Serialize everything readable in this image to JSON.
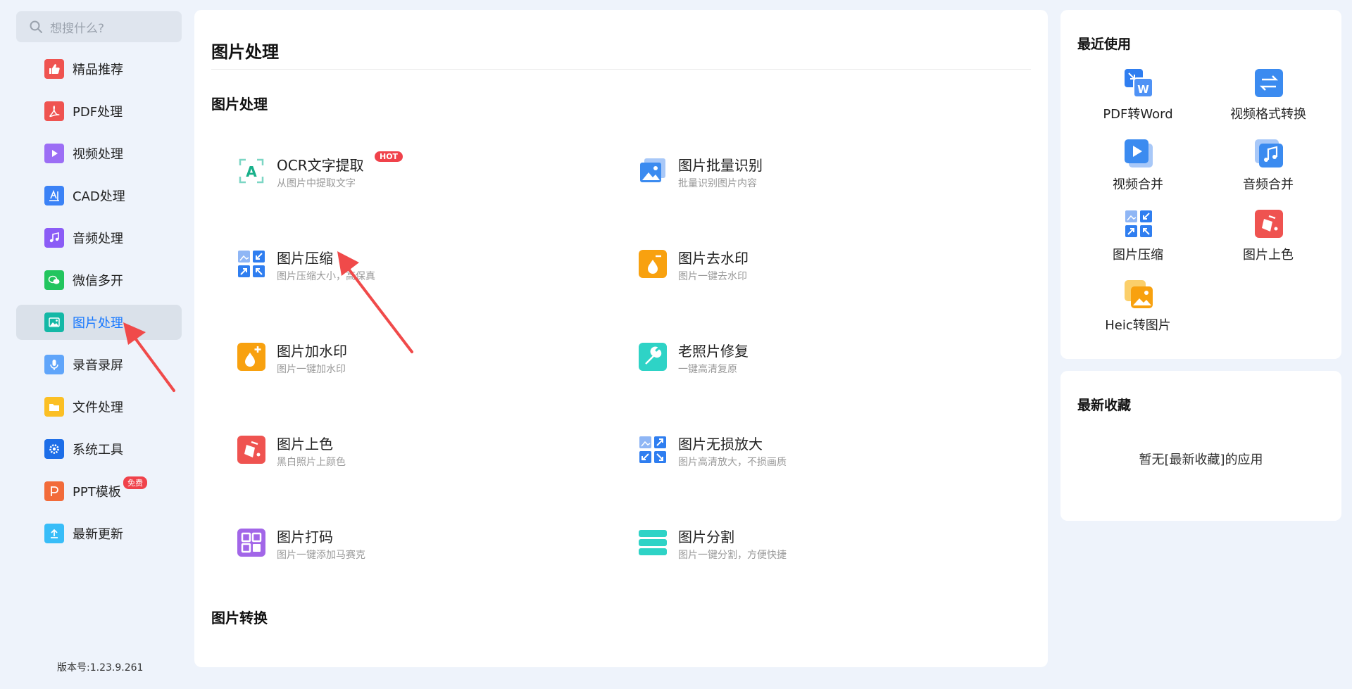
{
  "search": {
    "placeholder": "想搜什么?"
  },
  "sidebar": {
    "items": [
      {
        "label": "精品推荐",
        "icon": "thumbs-up-icon",
        "color": "#ef5350"
      },
      {
        "label": "PDF处理",
        "icon": "pdf-icon",
        "color": "#ef5350"
      },
      {
        "label": "视频处理",
        "icon": "video-play-icon",
        "color": "#9c6ef5"
      },
      {
        "label": "CAD处理",
        "icon": "cad-icon",
        "color": "#3b82f6"
      },
      {
        "label": "音频处理",
        "icon": "music-note-icon",
        "color": "#8b5cf6"
      },
      {
        "label": "微信多开",
        "icon": "wechat-icon",
        "color": "#22c55e"
      },
      {
        "label": "图片处理",
        "icon": "image-icon",
        "color": "#14b8a6"
      },
      {
        "label": "录音录屏",
        "icon": "microphone-icon",
        "color": "#60a5fa"
      },
      {
        "label": "文件处理",
        "icon": "folder-icon",
        "color": "#fbbf24"
      },
      {
        "label": "系统工具",
        "icon": "gear-icon",
        "color": "#1d6ee8"
      },
      {
        "label": "PPT模板",
        "icon": "ppt-icon",
        "color": "#f26b3a",
        "badge": "免费"
      },
      {
        "label": "最新更新",
        "icon": "upload-icon",
        "color": "#38bdf8"
      }
    ],
    "version": "版本号:1.23.9.261"
  },
  "main": {
    "title": "图片处理",
    "section1": "图片处理",
    "section2": "图片转换",
    "tools": [
      {
        "name": "OCR文字提取",
        "desc": "从图片中提取文字",
        "icon": "ocr-icon",
        "badge": "HOT"
      },
      {
        "name": "图片批量识别",
        "desc": "批量识别图片内容",
        "icon": "batch-image-icon"
      },
      {
        "name": "图片压缩",
        "desc": "图片压缩大小，高保真",
        "icon": "compress-icon"
      },
      {
        "name": "图片去水印",
        "desc": "图片一键去水印",
        "icon": "remove-watermark-icon"
      },
      {
        "name": "图片加水印",
        "desc": "图片一键加水印",
        "icon": "add-watermark-icon"
      },
      {
        "name": "老照片修复",
        "desc": "一键高清复原",
        "icon": "photo-repair-icon"
      },
      {
        "name": "图片上色",
        "desc": "黑白照片上颜色",
        "icon": "colorize-icon"
      },
      {
        "name": "图片无损放大",
        "desc": "图片高清放大，不损画质",
        "icon": "enlarge-icon"
      },
      {
        "name": "图片打码",
        "desc": "图片一键添加马赛克",
        "icon": "mosaic-icon"
      },
      {
        "name": "图片分割",
        "desc": "图片一键分割，方便快捷",
        "icon": "split-icon"
      }
    ]
  },
  "recent": {
    "title": "最近使用",
    "items": [
      {
        "label": "PDF转Word",
        "icon": "pdf-to-word-icon"
      },
      {
        "label": "视频格式转换",
        "icon": "video-convert-icon"
      },
      {
        "label": "视频合并",
        "icon": "video-merge-icon"
      },
      {
        "label": "音频合并",
        "icon": "audio-merge-icon"
      },
      {
        "label": "图片压缩",
        "icon": "compress-icon"
      },
      {
        "label": "图片上色",
        "icon": "colorize-icon"
      },
      {
        "label": "Heic转图片",
        "icon": "heic-convert-icon"
      }
    ]
  },
  "favorites": {
    "title": "最新收藏",
    "empty": "暂无[最新收藏]的应用"
  },
  "colors": {
    "accent": "#1677ff",
    "badge": "#f0424b",
    "arrow": "#f04a4a"
  }
}
